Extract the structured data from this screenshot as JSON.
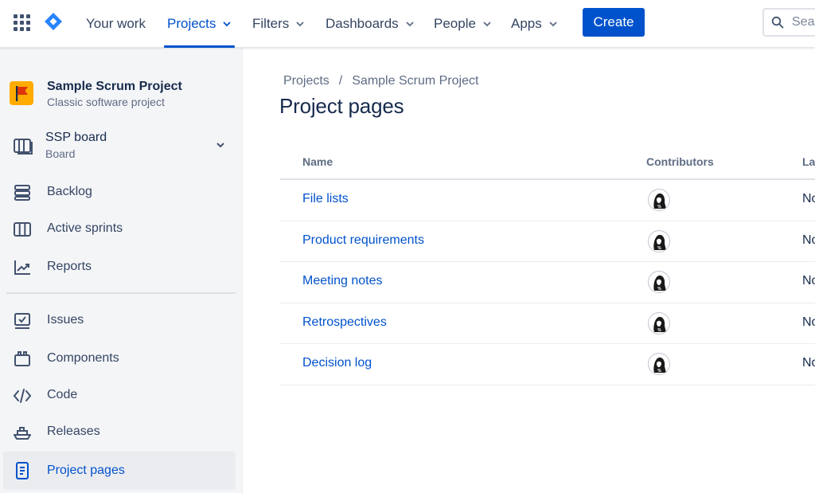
{
  "nav": {
    "items": [
      {
        "label": "Your work",
        "dropdown": false,
        "active": false
      },
      {
        "label": "Projects",
        "dropdown": true,
        "active": true
      },
      {
        "label": "Filters",
        "dropdown": true,
        "active": false
      },
      {
        "label": "Dashboards",
        "dropdown": true,
        "active": false
      },
      {
        "label": "People",
        "dropdown": true,
        "active": false
      },
      {
        "label": "Apps",
        "dropdown": true,
        "active": false
      }
    ],
    "create_label": "Create",
    "search_placeholder": "Search"
  },
  "colors": {
    "accent": "#0052cc",
    "text": "#172b4d",
    "subtle": "#5e6c84",
    "sidebar_bg": "#f4f5f7",
    "project_avatar": "#ffab00",
    "project_flag": "#de350b"
  },
  "sidebar": {
    "project_name": "Sample Scrum Project",
    "project_type": "Classic software project",
    "board": {
      "title": "SSP board",
      "subtitle": "Board"
    },
    "groups": [
      [
        {
          "label": "Backlog",
          "icon": "backlog-icon"
        },
        {
          "label": "Active sprints",
          "icon": "board-columns-icon"
        },
        {
          "label": "Reports",
          "icon": "chart-line-icon"
        }
      ],
      [
        {
          "label": "Issues",
          "icon": "issues-icon"
        },
        {
          "label": "Components",
          "icon": "component-icon"
        },
        {
          "label": "Code",
          "icon": "code-icon"
        },
        {
          "label": "Releases",
          "icon": "ship-icon"
        },
        {
          "label": "Project pages",
          "icon": "page-icon",
          "selected": true
        }
      ]
    ]
  },
  "main": {
    "breadcrumb": [
      "Projects",
      "Sample Scrum Project"
    ],
    "title": "Project pages",
    "table": {
      "columns": [
        "Name",
        "Contributors",
        "La"
      ],
      "rows": [
        {
          "name": "File lists",
          "updated": "No"
        },
        {
          "name": "Product requirements",
          "updated": "No"
        },
        {
          "name": "Meeting notes",
          "updated": "No"
        },
        {
          "name": "Retrospectives",
          "updated": "No"
        },
        {
          "name": "Decision log",
          "updated": "No"
        }
      ]
    }
  }
}
